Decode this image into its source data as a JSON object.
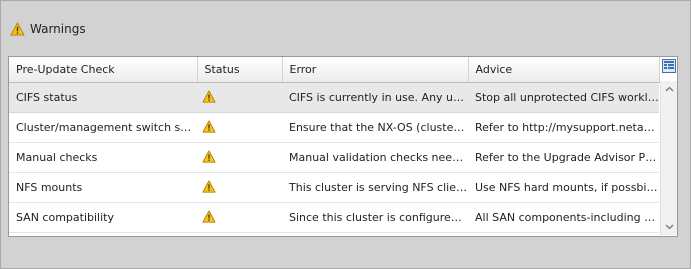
{
  "window": {
    "title": "Warnings",
    "title_icon": "warning-icon"
  },
  "colors": {
    "warning_fill": "#f7c21d",
    "warning_stroke": "#b07e00",
    "selected_row": "#e8e8e8",
    "panel_background": "#d2d2d2"
  },
  "table": {
    "columns": [
      {
        "label": "Pre-Update Check"
      },
      {
        "label": "Status"
      },
      {
        "label": "Error"
      },
      {
        "label": "Advice"
      }
    ],
    "rows": [
      {
        "check": "CIFS status",
        "status": "warning-icon",
        "error": "CIFS is currently in use. Any unprotect...",
        "advice": "Stop all unprotected CIFS workloads bef..."
      },
      {
        "check": "Cluster/management switch support",
        "status": "warning-icon",
        "error": "Ensure that the NX-OS (cluster networ...",
        "advice": "Refer to http://mysupport.netapp.com/..."
      },
      {
        "check": "Manual checks",
        "status": "warning-icon",
        "error": "Manual validation checks need to be p...",
        "advice": "Refer to the Upgrade Advisor Plan or \"P..."
      },
      {
        "check": "NFS mounts",
        "status": "warning-icon",
        "error": "This cluster is serving NFS clients. If NF...",
        "advice": "Use NFS hard mounts, if possbile."
      },
      {
        "check": "SAN compatibility",
        "status": "warning-icon",
        "error": "Since this cluster is configured for SAN...",
        "advice": "All SAN components-including target Da..."
      }
    ],
    "column_picker_icon": "column-chooser-icon",
    "scroll_up_icon": "chevron-up-icon",
    "scroll_down_icon": "chevron-down-icon"
  }
}
